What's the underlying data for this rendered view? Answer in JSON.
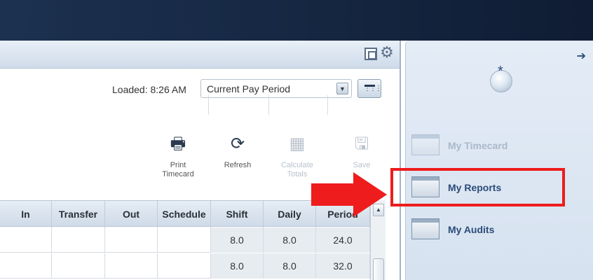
{
  "header": {
    "restore_icon": "restore-window-icon",
    "gear_icon": "gear-icon"
  },
  "loaded": {
    "label": "Loaded: 8:26 AM",
    "period_value": "Current Pay Period"
  },
  "toolbar": {
    "print_label": "Print Timecard",
    "print_line1": "Print",
    "print_line2": "Timecard",
    "refresh_label": "Refresh",
    "calc_line1": "Calculate",
    "calc_line2": "Totals",
    "save_label": "Save"
  },
  "grid": {
    "columns": [
      "In",
      "Transfer",
      "Out",
      "Schedule",
      "Shift",
      "Daily",
      "Period"
    ],
    "rows": [
      {
        "in": "",
        "transfer": "",
        "out": "",
        "schedule": "",
        "shift": "8.0",
        "daily": "8.0",
        "period": "24.0"
      },
      {
        "in": "",
        "transfer": "",
        "out": "",
        "schedule": "",
        "shift": "8.0",
        "daily": "8.0",
        "period": "32.0"
      }
    ]
  },
  "sidebar": {
    "items": [
      {
        "label": "My Timecard",
        "state": "disabled"
      },
      {
        "label": "My Reports",
        "state": "highlighted"
      },
      {
        "label": "My Audits",
        "state": "enabled"
      }
    ]
  },
  "colors": {
    "highlight": "#ee1c1c",
    "link": "#2b4c78",
    "topbar": "#14253f"
  }
}
